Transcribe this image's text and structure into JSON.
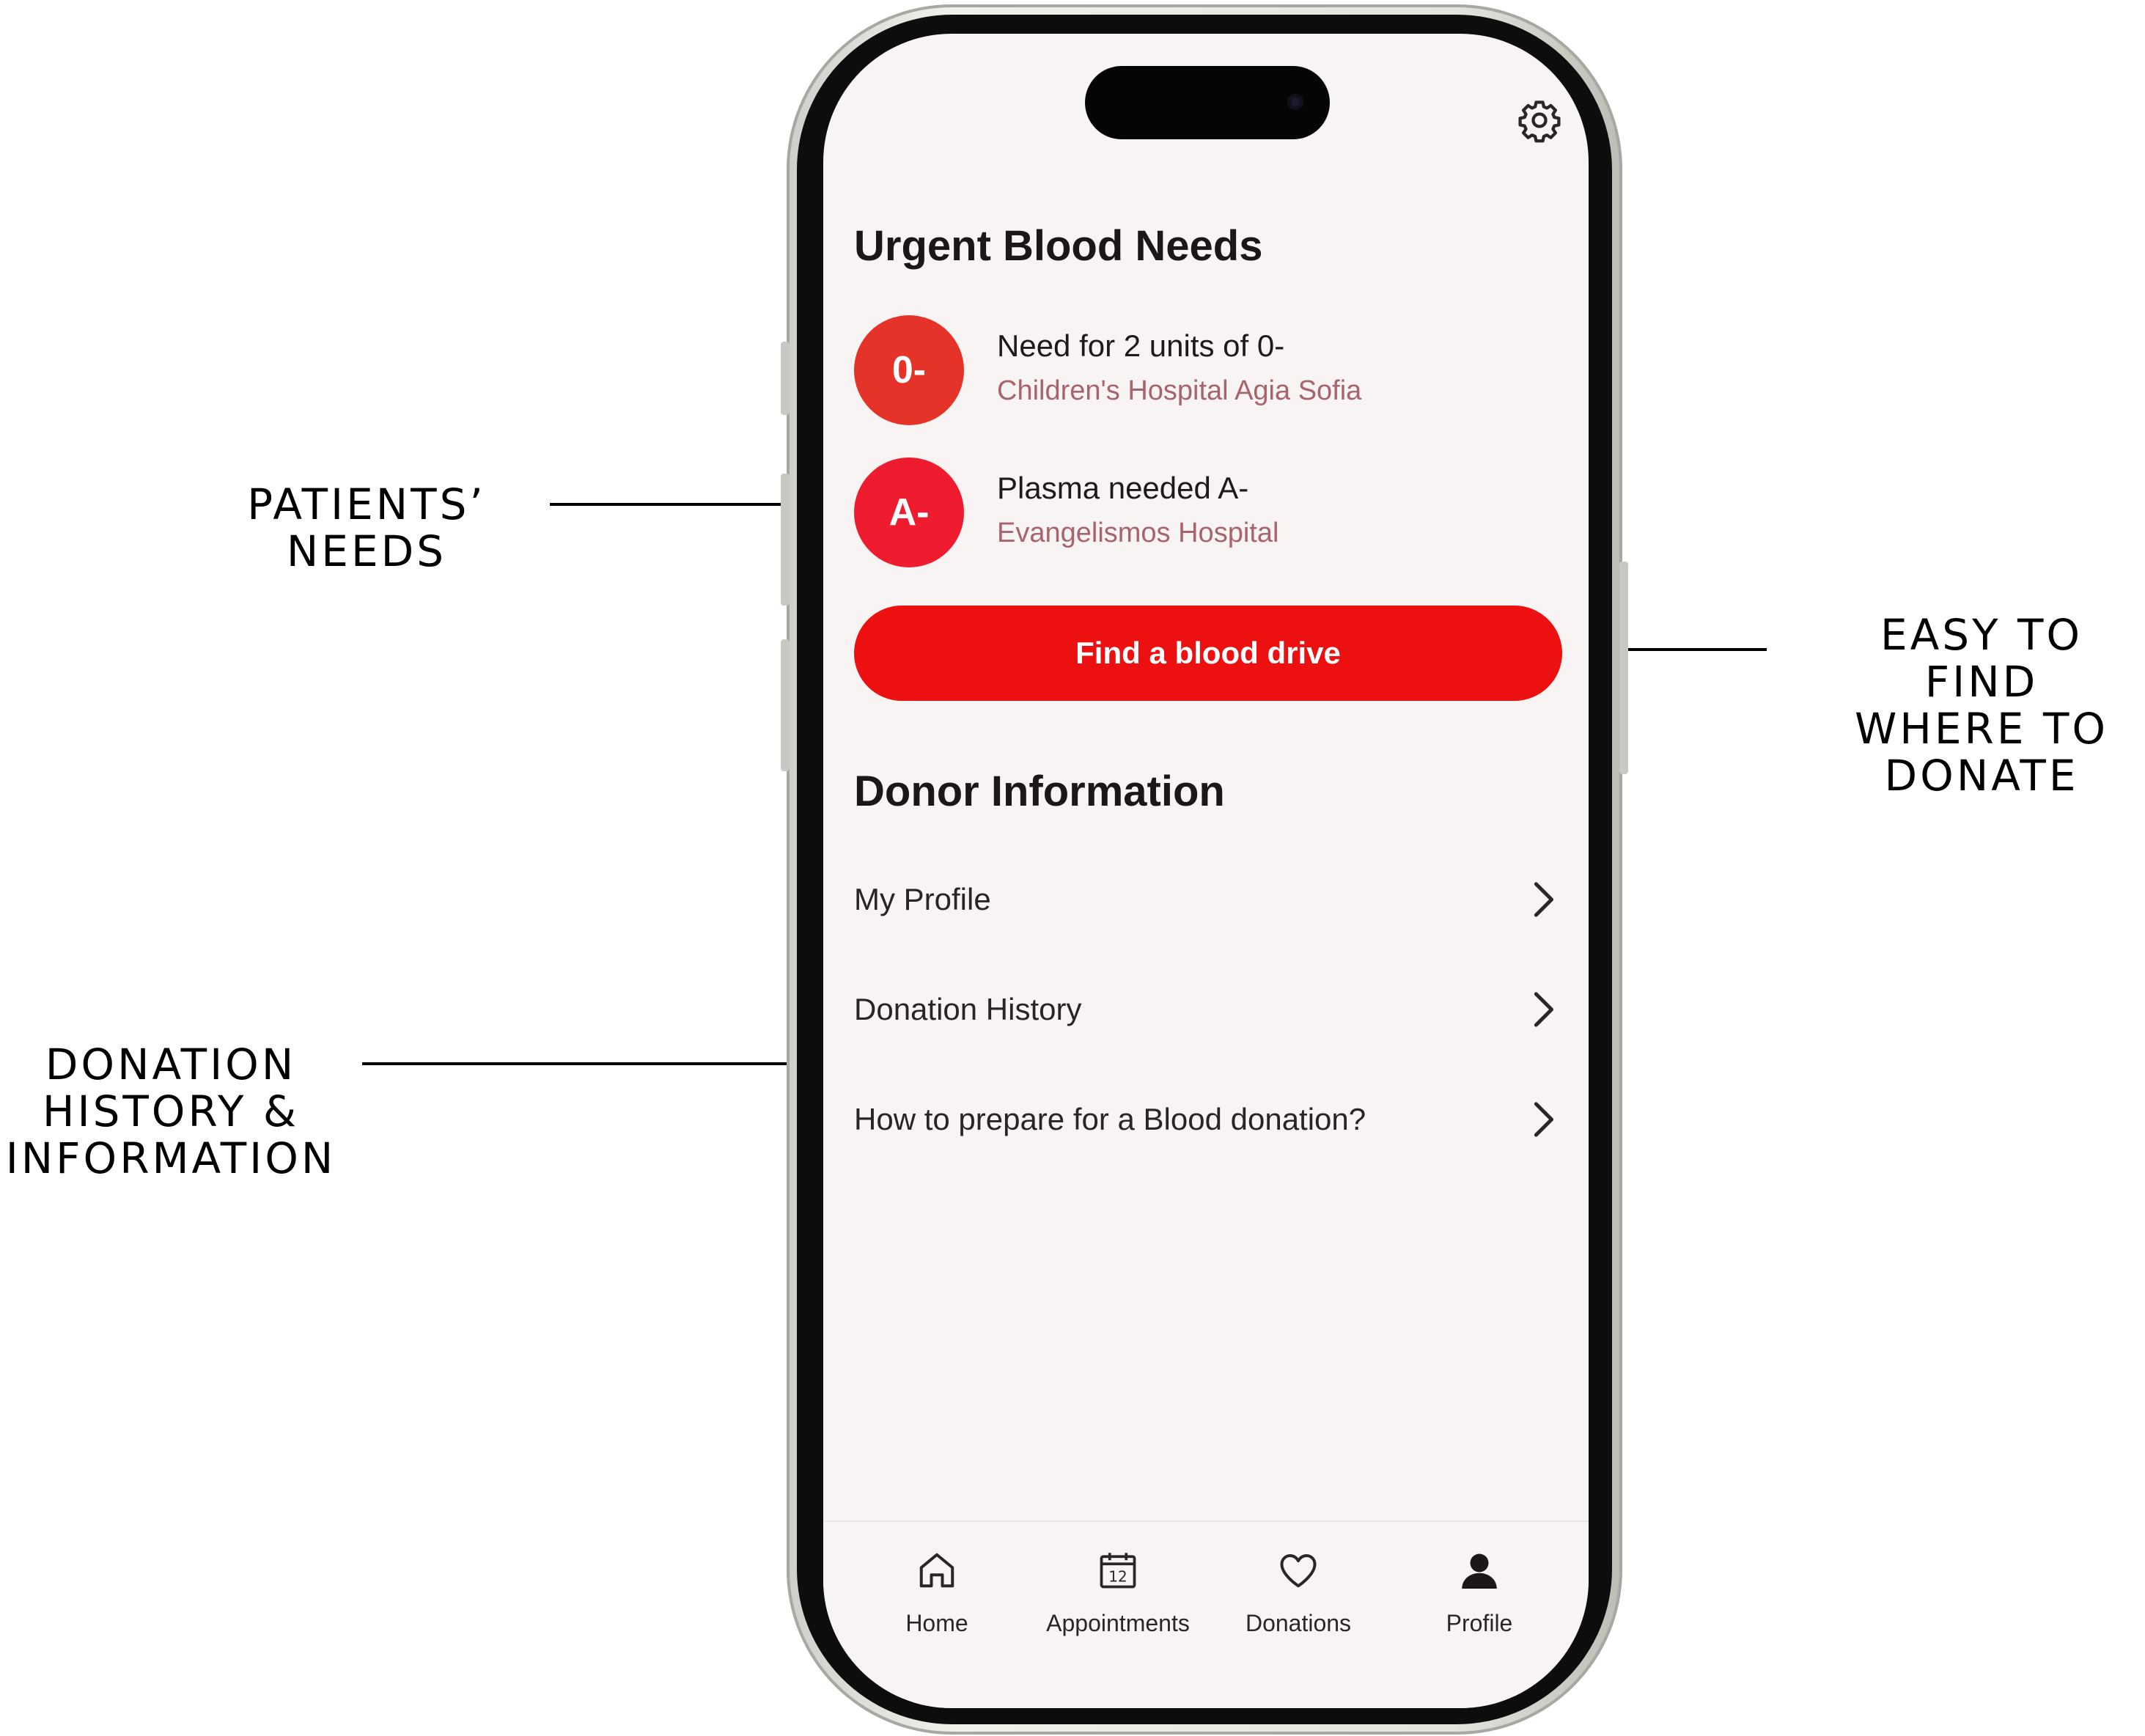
{
  "callouts": {
    "patients_needs": [
      "PATIENTS’",
      "NEEDS"
    ],
    "easy_to_find": [
      "EASY TO FIND",
      "WHERE TO",
      "DONATE"
    ],
    "donation_history": [
      "DONATION",
      "HISTORY &",
      "INFORMATION"
    ]
  },
  "screen": {
    "settings_icon": "gear-icon",
    "urgent_title": "Urgent Blood Needs",
    "needs": [
      {
        "badge": "0-",
        "title": "Need for 2 units of 0-",
        "location": "Children's Hospital Agia Sofia",
        "color": "#e5332a"
      },
      {
        "badge": "A-",
        "title": "Plasma needed A-",
        "location": "Evangelismos Hospital",
        "color": "#ee1c2e"
      }
    ],
    "find_button": "Find a blood drive",
    "donor_title": "Donor Information",
    "donor_items": [
      {
        "label": "My Profile"
      },
      {
        "label": "Donation History"
      },
      {
        "label": "How to prepare for a Blood donation?"
      }
    ],
    "tabs": [
      {
        "label": "Home",
        "icon": "home-icon"
      },
      {
        "label": "Appointments",
        "icon": "calendar-icon",
        "calendar_day": "12"
      },
      {
        "label": "Donations",
        "icon": "heart-icon"
      },
      {
        "label": "Profile",
        "icon": "person-icon"
      }
    ]
  },
  "colors": {
    "accent": "#ed1010",
    "background": "#f7f4f3",
    "subtitle": "#a8646c"
  }
}
